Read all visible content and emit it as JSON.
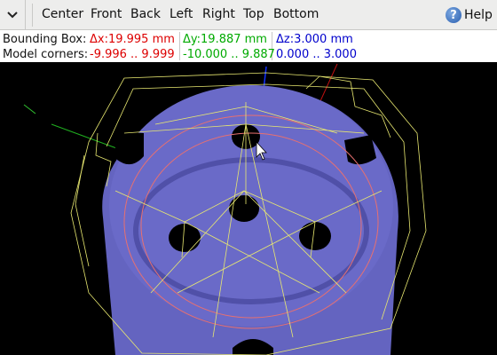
{
  "toolbar": {
    "views": [
      "Center",
      "Front",
      "Back",
      "Left",
      "Right",
      "Top",
      "Bottom"
    ],
    "help_label": "Help"
  },
  "info": {
    "bbox_label": "Bounding Box:",
    "dx": "Δx:19.995 mm",
    "dy": "Δy:19.887 mm",
    "dz": "Δz:3.000 mm",
    "corners_label": "Model corners:",
    "x_range": "-9.996 .. 9.999",
    "y_range": "-10.000 .. 9.887",
    "z_range": "0.000 .. 3.000"
  },
  "colors": {
    "x": "#dd0000",
    "y": "#00aa00",
    "z": "#0000cc",
    "model": "#6a6ac6",
    "wire": "#e8e870",
    "circle": "#e87070"
  },
  "icons": [
    "chevron-down-icon",
    "help-icon",
    "cursor-icon"
  ]
}
